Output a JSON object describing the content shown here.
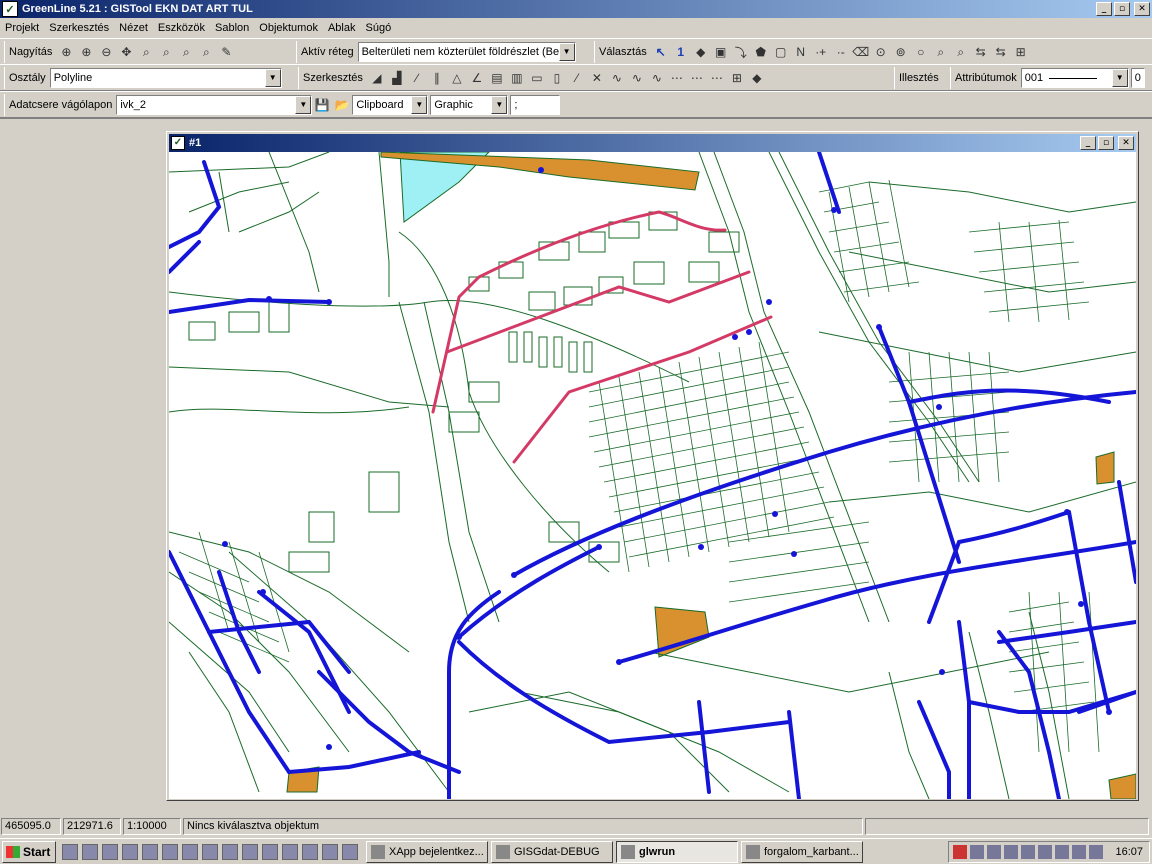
{
  "app": {
    "title": "GreenLine 5.21 : GISTool EKN DAT ART TUL",
    "window_controls": [
      "_",
      "▫",
      "✕"
    ]
  },
  "menu": [
    "Projekt",
    "Szerkesztés",
    "Nézet",
    "Eszközök",
    "Sablon",
    "Objektumok",
    "Ablak",
    "Súgó"
  ],
  "toolbar": {
    "zoom_label": "Nagyítás",
    "layer_label": "Aktív réteg",
    "layer_value": "Belterületi nem közterület földrészlet (Belte",
    "select_label": "Választás",
    "select_number": "1",
    "class_label": "Osztály",
    "class_value": "Polyline",
    "edit_label": "Szerkesztés",
    "fit_label": "Illesztés",
    "attrib_label": "Attribútumok",
    "attrib_value": "001",
    "attrib_num": "0",
    "exchange_label": "Adatcsere vágólapon",
    "exchange_value": "ivk_2",
    "clipboard_value": "Clipboard",
    "graphic_value": "Graphic",
    "sep_value": ";"
  },
  "child_window": {
    "title": "#1"
  },
  "colors": {
    "map_lines": "#1a6b2a",
    "roads": "#1515d8",
    "selected": "#d43a66",
    "building_fill": "#d9902e",
    "water_fill": "#9ff0f5"
  },
  "statusbar": {
    "x": "465095.0",
    "y": "212971.6",
    "scale": "1:10000",
    "message": "Nincs kiválasztva objektum"
  },
  "taskbar": {
    "start": "Start",
    "tasks": [
      "XApp bejelentkez...",
      "GISGdat-DEBUG",
      "glwrun",
      "forgalom_karbant..."
    ],
    "active_task": "glwrun",
    "clock": "16:07"
  }
}
